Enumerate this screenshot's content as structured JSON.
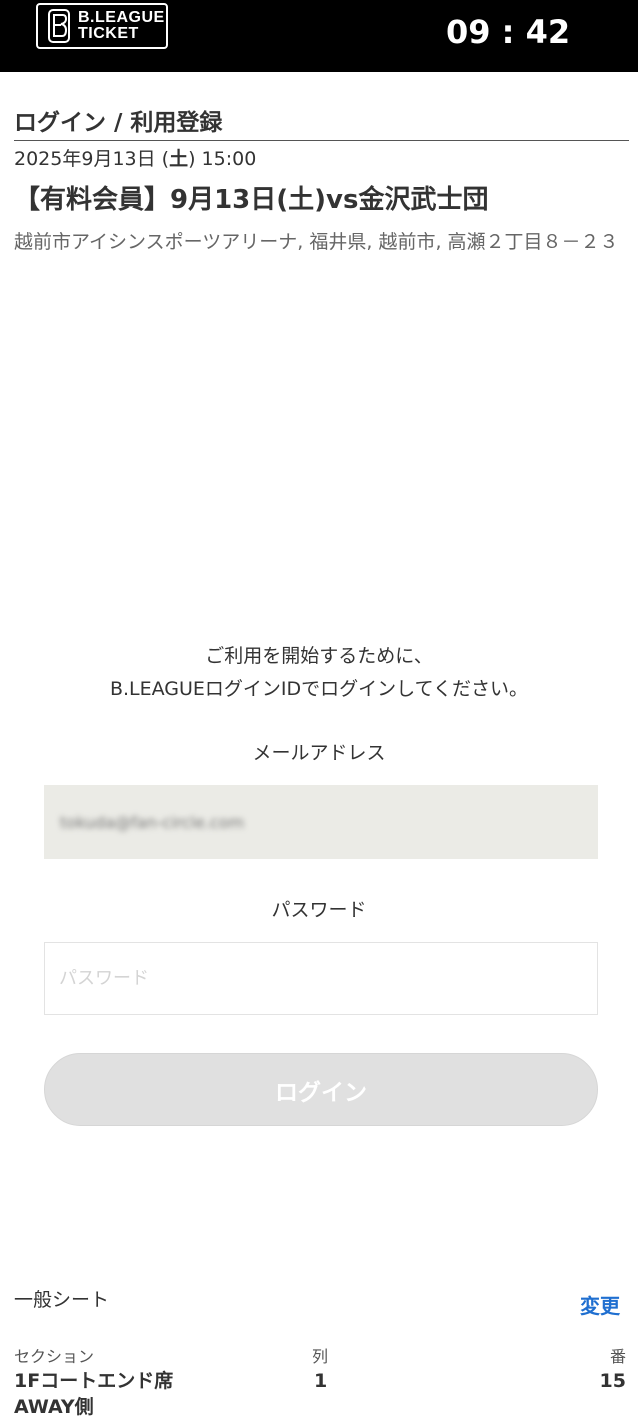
{
  "header": {
    "logo_line1": "B.LEAGUE",
    "logo_line2": "TICKET",
    "timer": "09 : 42",
    "background_color": "#000000"
  },
  "page": {
    "title": "ログイン / 利用登録"
  },
  "event": {
    "date_prefix": "2025年9月13日 (",
    "day_of_week": "土",
    "date_suffix": ") 15:00",
    "name": "【有料会員】9月13日(土)vs金沢武士団",
    "venue": "越前市アイシンスポーツアリーナ, 福井県, 越前市, 高瀬２丁目８－２３"
  },
  "login": {
    "intro_line1": "ご利用を開始するために、",
    "intro_line2": "B.LEAGUEログインIDでログインしてください。",
    "email_label": "メールアドレス",
    "email_value": "tokuda@fan-circle.com",
    "password_label": "パスワード",
    "password_placeholder": "パスワード",
    "button_label": "ログイン"
  },
  "seat": {
    "type": "一般シート",
    "change_label": "変更",
    "section_label": "セクション",
    "section_value_line1": "1Fコートエンド席",
    "section_value_line2": "AWAY側",
    "row_label": "列",
    "row_value": "1",
    "number_label": "番",
    "number_value": "15"
  },
  "colors": {
    "accent_link": "#1f6fd0",
    "field_fill": "#ebebe6",
    "button_disabled": "#e0e0e0"
  }
}
